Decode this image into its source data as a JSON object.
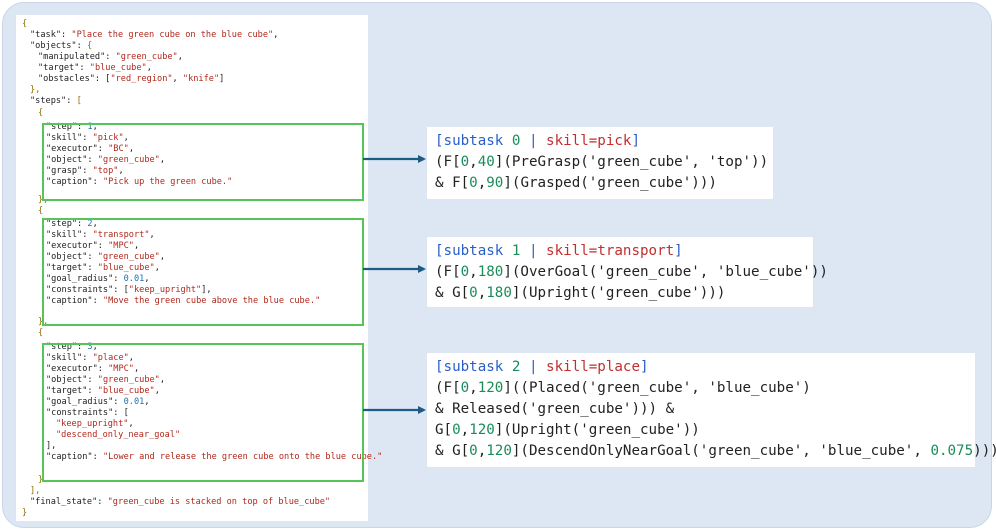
{
  "json_lines": {
    "l00": "{",
    "l01k": "\"task\"",
    "l01v": "\"Place the green cube on the blue cube\"",
    "l02k": "\"objects\"",
    "l03k": "\"manipulated\"",
    "l03v": "\"green_cube\"",
    "l04k": "\"target\"",
    "l04v": "\"blue_cube\"",
    "l05k": "\"obstacles\"",
    "l05v1": "\"red_region\"",
    "l05v2": "\"knife\"",
    "l06": "},",
    "l07k": "\"steps\"",
    "l08": "{",
    "l09k": "\"step\"",
    "l09v": "1",
    "l10k": "\"skill\"",
    "l10v": "\"pick\"",
    "l11k": "\"executor\"",
    "l11v": "\"BC\"",
    "l12k": "\"object\"",
    "l12v": "\"green_cube\"",
    "l13k": "\"grasp\"",
    "l13v": "\"top\"",
    "l14k": "\"caption\"",
    "l14v": "\"Pick up the green cube.\"",
    "l15": "},",
    "l16": "{",
    "l17k": "\"step\"",
    "l17v": "2",
    "l18k": "\"skill\"",
    "l18v": "\"transport\"",
    "l19k": "\"executor\"",
    "l19v": "\"MPC\"",
    "l20k": "\"object\"",
    "l20v": "\"green_cube\"",
    "l21k": "\"target\"",
    "l21v": "\"blue_cube\"",
    "l22k": "\"goal_radius\"",
    "l22v": "0.01",
    "l23k": "\"constraints\"",
    "l23v": "\"keep_upright\"",
    "l24k": "\"caption\"",
    "l24v": "\"Move the green cube above the blue cube.\"",
    "l25": "},",
    "l26": "{",
    "l27k": "\"step\"",
    "l27v": "3",
    "l28k": "\"skill\"",
    "l28v": "\"place\"",
    "l29k": "\"executor\"",
    "l29v": "\"MPC\"",
    "l30k": "\"object\"",
    "l30v": "\"green_cube\"",
    "l31k": "\"target\"",
    "l31v": "\"blue_cube\"",
    "l32k": "\"goal_radius\"",
    "l32v": "0.01",
    "l33k": "\"constraints\"",
    "l34v": "\"keep_upright\"",
    "l35v": "\"descend_only_near_goal\"",
    "l36": "],",
    "l37k": "\"caption\"",
    "l37v": "\"Lower and release the green cube onto the blue cube.\"",
    "l38": "}",
    "l39": "],",
    "l40k": "\"final_state\"",
    "l40v": "\"green_cube is stacked on top of blue_cube\"",
    "l41": "}"
  },
  "subtasks": [
    {
      "header_open": "[subtask ",
      "index": "0",
      "header_sep": " | ",
      "skill": "skill=pick",
      "header_close": "]",
      "lines": [
        {
          "a": "(F[",
          "n1": "0",
          "b": ",",
          "n2": "40",
          "c": "](PreGrasp('green_cube', 'top'))"
        },
        {
          "a": "& F[",
          "n1": "0",
          "b": ",",
          "n2": "90",
          "c": "](Grasped('green_cube')))"
        }
      ]
    },
    {
      "header_open": "[subtask ",
      "index": "1",
      "header_sep": " | ",
      "skill": "skill=transport",
      "header_close": "]",
      "lines": [
        {
          "a": "(F[",
          "n1": "0",
          "b": ",",
          "n2": "180",
          "c": "](OverGoal('green_cube', 'blue_cube'))"
        },
        {
          "a": "& G[",
          "n1": "0",
          "b": ",",
          "n2": "180",
          "c": "](Upright('green_cube')))"
        }
      ]
    },
    {
      "header_open": "[subtask ",
      "index": "2",
      "header_sep": " | ",
      "skill": "skill=place",
      "header_close": "]",
      "lines": [
        {
          "a": "(F[",
          "n1": "0",
          "b": ",",
          "n2": "120",
          "c": "]((Placed('green_cube', 'blue_cube')"
        },
        {
          "a": "& Released('green_cube'))) &",
          "n1": "",
          "b": "",
          "n2": "",
          "c": ""
        },
        {
          "a": "G[",
          "n1": "0",
          "b": ",",
          "n2": "120",
          "c": "](Upright('green_cube'))"
        },
        {
          "a": "& G[",
          "n1": "0",
          "b": ",",
          "n2": "120",
          "c": "](DescendOnlyNearGoal('green_cube', 'blue_cube', ",
          "n3": "0.075",
          "d": ")))"
        }
      ]
    }
  ],
  "colors": {
    "panel_bg": "#dce7f3",
    "step_box": "#57c45a",
    "arrow": "#1f5a85",
    "string": "#b0281c",
    "number": "#1a8c5a",
    "header_blue": "#2a5ec7",
    "header_red": "#c02f2f"
  }
}
